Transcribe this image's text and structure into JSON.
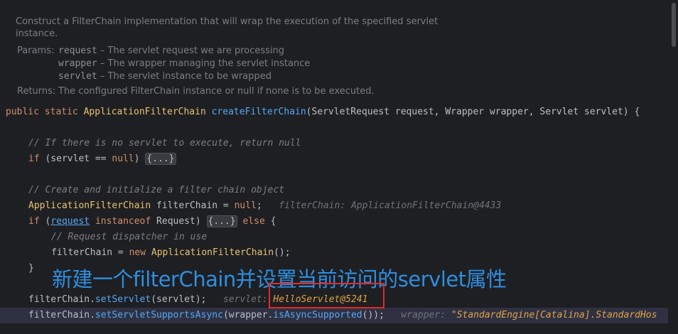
{
  "doc": {
    "description": "Construct a FilterChain implementation that will wrap the execution of the specified servlet instance.",
    "params_label": "Params:",
    "params": [
      {
        "name": "request",
        "text": " – The servlet request we are processing"
      },
      {
        "name": "wrapper",
        "text": " – The wrapper managing the servlet instance"
      },
      {
        "name": "servlet",
        "text": " – The servlet instance to be wrapped"
      }
    ],
    "returns_label": "Returns:",
    "returns": "The configured FilterChain instance or null if none is to be executed."
  },
  "code": {
    "l1_kw1": "public",
    "l1_kw2": "static",
    "l1_type": "ApplicationFilterChain",
    "l1_fn": "createFilterChain",
    "l1_rest": "(ServletRequest request, Wrapper wrapper, Servlet servlet) {",
    "l2_comment": "// If there is no servlet to execute, return null",
    "l3_if": "if",
    "l3_cond": " (servlet == ",
    "l3_null": "null",
    "l3_close": ") ",
    "l3_fold": "{...}",
    "l4_comment": "// Create and initialize a filter chain object",
    "l5_type": "ApplicationFilterChain",
    "l5_rest": " filterChain = ",
    "l5_null": "null",
    "l5_semi": ";",
    "l5_hint": "filterChain: ApplicationFilterChain@4433",
    "l6_if": "if",
    "l6_open": " (",
    "l6_request": "request",
    "l6_instanceof": "instanceof",
    "l6_req": " Request) ",
    "l6_fold": "{...}",
    "l6_else": "else",
    "l6_brace": " {",
    "l7_comment": "// Request dispatcher in use",
    "l8_start": "filterChain = ",
    "l8_new": "new",
    "l8_cls": "ApplicationFilterChain",
    "l8_end": "();",
    "l9_brace": "}",
    "l10_obj": "filterChain.",
    "l10_fn": "setServlet",
    "l10_args": "(servlet);",
    "l10_hint_label": "servlet:",
    "l10_hint_value": "HelloServlet@5241",
    "l11_obj": "filterChain.",
    "l11_fn": "setServletSupportsAsync",
    "l11_args": "(wrapper.",
    "l11_fn2": "isAsyncSupported",
    "l11_end": "());",
    "l11_hint_label": "wrapper:",
    "l11_hint_value": "\"StandardEngine[Catalina].StandardHos"
  },
  "annotation": "新建一个filterChain并设置当前访问的servlet属性",
  "colors": {
    "background": "#1e1f22",
    "keyword": "#cf8e6d",
    "function": "#56a8f5",
    "comment": "#7a7e85",
    "annotation": "#2f8ee0",
    "highlight_box": "#e02a2a"
  }
}
